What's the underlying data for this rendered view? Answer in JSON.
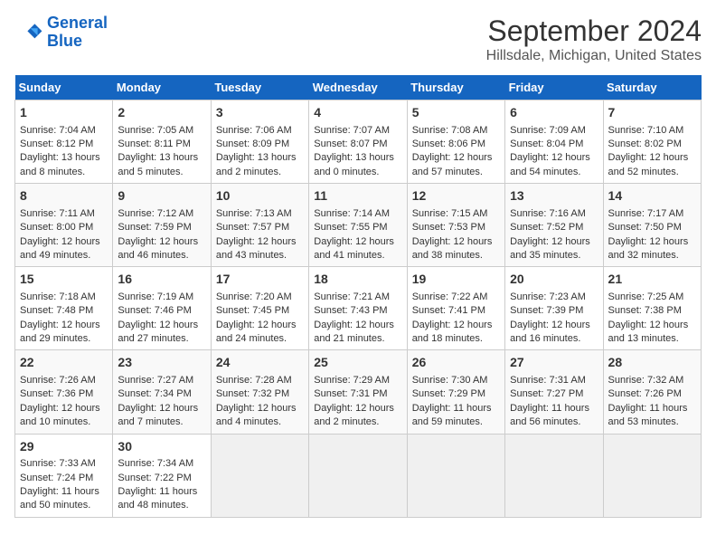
{
  "logo": {
    "line1": "General",
    "line2": "Blue"
  },
  "title": "September 2024",
  "subtitle": "Hillsdale, Michigan, United States",
  "days_of_week": [
    "Sunday",
    "Monday",
    "Tuesday",
    "Wednesday",
    "Thursday",
    "Friday",
    "Saturday"
  ],
  "weeks": [
    [
      {
        "day": "1",
        "lines": [
          "Sunrise: 7:04 AM",
          "Sunset: 8:12 PM",
          "Daylight: 13 hours",
          "and 8 minutes."
        ]
      },
      {
        "day": "2",
        "lines": [
          "Sunrise: 7:05 AM",
          "Sunset: 8:11 PM",
          "Daylight: 13 hours",
          "and 5 minutes."
        ]
      },
      {
        "day": "3",
        "lines": [
          "Sunrise: 7:06 AM",
          "Sunset: 8:09 PM",
          "Daylight: 13 hours",
          "and 2 minutes."
        ]
      },
      {
        "day": "4",
        "lines": [
          "Sunrise: 7:07 AM",
          "Sunset: 8:07 PM",
          "Daylight: 13 hours",
          "and 0 minutes."
        ]
      },
      {
        "day": "5",
        "lines": [
          "Sunrise: 7:08 AM",
          "Sunset: 8:06 PM",
          "Daylight: 12 hours",
          "and 57 minutes."
        ]
      },
      {
        "day": "6",
        "lines": [
          "Sunrise: 7:09 AM",
          "Sunset: 8:04 PM",
          "Daylight: 12 hours",
          "and 54 minutes."
        ]
      },
      {
        "day": "7",
        "lines": [
          "Sunrise: 7:10 AM",
          "Sunset: 8:02 PM",
          "Daylight: 12 hours",
          "and 52 minutes."
        ]
      }
    ],
    [
      {
        "day": "8",
        "lines": [
          "Sunrise: 7:11 AM",
          "Sunset: 8:00 PM",
          "Daylight: 12 hours",
          "and 49 minutes."
        ]
      },
      {
        "day": "9",
        "lines": [
          "Sunrise: 7:12 AM",
          "Sunset: 7:59 PM",
          "Daylight: 12 hours",
          "and 46 minutes."
        ]
      },
      {
        "day": "10",
        "lines": [
          "Sunrise: 7:13 AM",
          "Sunset: 7:57 PM",
          "Daylight: 12 hours",
          "and 43 minutes."
        ]
      },
      {
        "day": "11",
        "lines": [
          "Sunrise: 7:14 AM",
          "Sunset: 7:55 PM",
          "Daylight: 12 hours",
          "and 41 minutes."
        ]
      },
      {
        "day": "12",
        "lines": [
          "Sunrise: 7:15 AM",
          "Sunset: 7:53 PM",
          "Daylight: 12 hours",
          "and 38 minutes."
        ]
      },
      {
        "day": "13",
        "lines": [
          "Sunrise: 7:16 AM",
          "Sunset: 7:52 PM",
          "Daylight: 12 hours",
          "and 35 minutes."
        ]
      },
      {
        "day": "14",
        "lines": [
          "Sunrise: 7:17 AM",
          "Sunset: 7:50 PM",
          "Daylight: 12 hours",
          "and 32 minutes."
        ]
      }
    ],
    [
      {
        "day": "15",
        "lines": [
          "Sunrise: 7:18 AM",
          "Sunset: 7:48 PM",
          "Daylight: 12 hours",
          "and 29 minutes."
        ]
      },
      {
        "day": "16",
        "lines": [
          "Sunrise: 7:19 AM",
          "Sunset: 7:46 PM",
          "Daylight: 12 hours",
          "and 27 minutes."
        ]
      },
      {
        "day": "17",
        "lines": [
          "Sunrise: 7:20 AM",
          "Sunset: 7:45 PM",
          "Daylight: 12 hours",
          "and 24 minutes."
        ]
      },
      {
        "day": "18",
        "lines": [
          "Sunrise: 7:21 AM",
          "Sunset: 7:43 PM",
          "Daylight: 12 hours",
          "and 21 minutes."
        ]
      },
      {
        "day": "19",
        "lines": [
          "Sunrise: 7:22 AM",
          "Sunset: 7:41 PM",
          "Daylight: 12 hours",
          "and 18 minutes."
        ]
      },
      {
        "day": "20",
        "lines": [
          "Sunrise: 7:23 AM",
          "Sunset: 7:39 PM",
          "Daylight: 12 hours",
          "and 16 minutes."
        ]
      },
      {
        "day": "21",
        "lines": [
          "Sunrise: 7:25 AM",
          "Sunset: 7:38 PM",
          "Daylight: 12 hours",
          "and 13 minutes."
        ]
      }
    ],
    [
      {
        "day": "22",
        "lines": [
          "Sunrise: 7:26 AM",
          "Sunset: 7:36 PM",
          "Daylight: 12 hours",
          "and 10 minutes."
        ]
      },
      {
        "day": "23",
        "lines": [
          "Sunrise: 7:27 AM",
          "Sunset: 7:34 PM",
          "Daylight: 12 hours",
          "and 7 minutes."
        ]
      },
      {
        "day": "24",
        "lines": [
          "Sunrise: 7:28 AM",
          "Sunset: 7:32 PM",
          "Daylight: 12 hours",
          "and 4 minutes."
        ]
      },
      {
        "day": "25",
        "lines": [
          "Sunrise: 7:29 AM",
          "Sunset: 7:31 PM",
          "Daylight: 12 hours",
          "and 2 minutes."
        ]
      },
      {
        "day": "26",
        "lines": [
          "Sunrise: 7:30 AM",
          "Sunset: 7:29 PM",
          "Daylight: 11 hours",
          "and 59 minutes."
        ]
      },
      {
        "day": "27",
        "lines": [
          "Sunrise: 7:31 AM",
          "Sunset: 7:27 PM",
          "Daylight: 11 hours",
          "and 56 minutes."
        ]
      },
      {
        "day": "28",
        "lines": [
          "Sunrise: 7:32 AM",
          "Sunset: 7:26 PM",
          "Daylight: 11 hours",
          "and 53 minutes."
        ]
      }
    ],
    [
      {
        "day": "29",
        "lines": [
          "Sunrise: 7:33 AM",
          "Sunset: 7:24 PM",
          "Daylight: 11 hours",
          "and 50 minutes."
        ]
      },
      {
        "day": "30",
        "lines": [
          "Sunrise: 7:34 AM",
          "Sunset: 7:22 PM",
          "Daylight: 11 hours",
          "and 48 minutes."
        ]
      },
      {
        "day": "",
        "lines": []
      },
      {
        "day": "",
        "lines": []
      },
      {
        "day": "",
        "lines": []
      },
      {
        "day": "",
        "lines": []
      },
      {
        "day": "",
        "lines": []
      }
    ]
  ]
}
